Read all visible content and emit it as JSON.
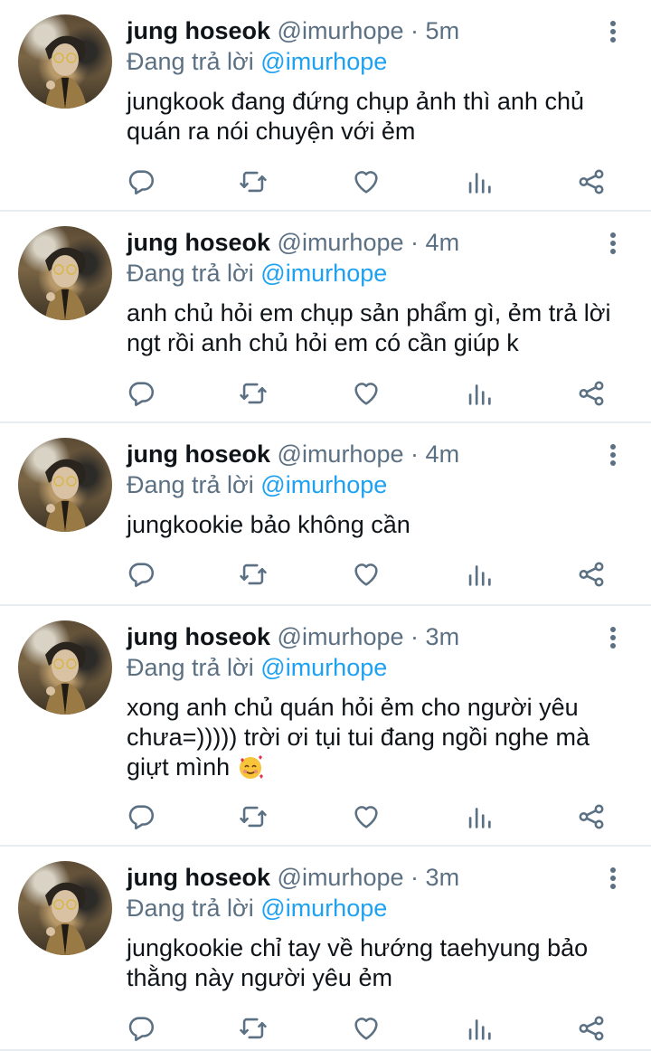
{
  "tweets": [
    {
      "name": "jung hoseok",
      "handle": "@imurhope",
      "dot": "·",
      "time": "5m",
      "reply_prefix": "Đang trả lời",
      "reply_to": "@imurhope",
      "lines": [
        "jungkook đang đứng chụp ảnh thì anh chủ",
        "quán ra nói chuyện với ẻm"
      ],
      "emoji": ""
    },
    {
      "name": "jung hoseok",
      "handle": "@imurhope",
      "dot": "·",
      "time": "4m",
      "reply_prefix": "Đang trả lời",
      "reply_to": "@imurhope",
      "lines": [
        "anh chủ hỏi em chụp sản phẩm gì, ẻm trả lời",
        "ngt rồi anh chủ hỏi em có cần giúp k"
      ],
      "emoji": ""
    },
    {
      "name": "jung hoseok",
      "handle": "@imurhope",
      "dot": "·",
      "time": "4m",
      "reply_prefix": "Đang trả lời",
      "reply_to": "@imurhope",
      "lines": [
        "jungkookie bảo không cần"
      ],
      "emoji": ""
    },
    {
      "name": "jung hoseok",
      "handle": "@imurhope",
      "dot": "·",
      "time": "3m",
      "reply_prefix": "Đang trả lời",
      "reply_to": "@imurhope",
      "lines": [
        "xong anh chủ quán hỏi ẻm cho người yêu",
        "chưa=))))) trời ơi tụi tui đang ngồi nghe mà",
        "giựt mình"
      ],
      "emoji": "smiling-face-with-hearts"
    },
    {
      "name": "jung hoseok",
      "handle": "@imurhope",
      "dot": "·",
      "time": "3m",
      "reply_prefix": "Đang trả lời",
      "reply_to": "@imurhope",
      "lines": [
        "jungkookie chỉ tay về hướng taehyung bảo",
        "thằng này người yêu ẻm"
      ],
      "emoji": ""
    }
  ],
  "icons": {
    "more": "more-vertical-icon",
    "reply": "reply-icon",
    "retweet": "retweet-icon",
    "like": "like-icon",
    "analytics": "analytics-icon",
    "share": "share-icon"
  },
  "colors": {
    "text": "#0f1419",
    "secondary": "#5b7083",
    "mention": "#1da1f2",
    "divider": "#e6ecf0"
  }
}
